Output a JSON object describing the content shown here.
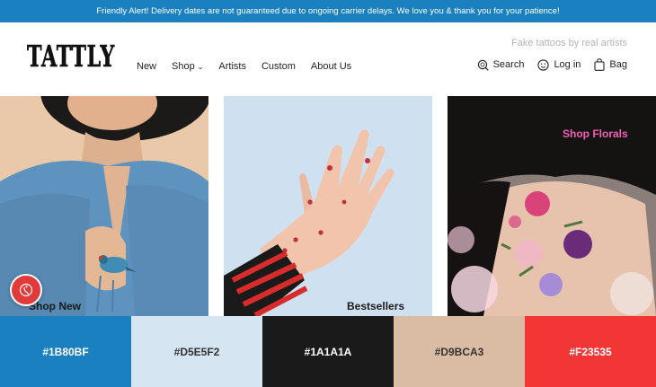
{
  "alert": {
    "text": "Friendly Alert! Delivery dates are not guaranteed due to ongoing carrier delays. We love you & thank you for your patience!"
  },
  "header": {
    "logo_text": "TATTLY",
    "tagline": "Fake tattoos by real artists",
    "nav": [
      {
        "label": "New"
      },
      {
        "label": "Shop"
      },
      {
        "label": "Artists"
      },
      {
        "label": "Custom"
      },
      {
        "label": "About Us"
      }
    ],
    "utils": {
      "search": "Search",
      "login": "Log in",
      "bag": "Bag"
    }
  },
  "tiles": [
    {
      "label": "Shop New"
    },
    {
      "label": "Bestsellers"
    },
    {
      "label": "Shop Florals"
    }
  ],
  "swatches": [
    {
      "label": "#1B80BF",
      "color": "#1B80BF",
      "text_color": "#ffffff"
    },
    {
      "label": "#D5E5F2",
      "color": "#D5E5F2",
      "text_color": "#333333"
    },
    {
      "label": "#1A1A1A",
      "color": "#1A1A1A",
      "text_color": "#ffffff"
    },
    {
      "label": "#D9BCA3",
      "color": "#D9BCA3",
      "text_color": "#333333"
    },
    {
      "label": "#F23535",
      "color": "#F23535",
      "text_color": "#ffffff"
    }
  ],
  "colors": {
    "alert_bg": "#1b80bf",
    "florals_label": "#f062b4",
    "fab_bg": "#e23a3a"
  },
  "icons": [
    "search-icon",
    "smiley-icon",
    "bag-icon",
    "chevron-down-icon",
    "accessibility-icon"
  ]
}
